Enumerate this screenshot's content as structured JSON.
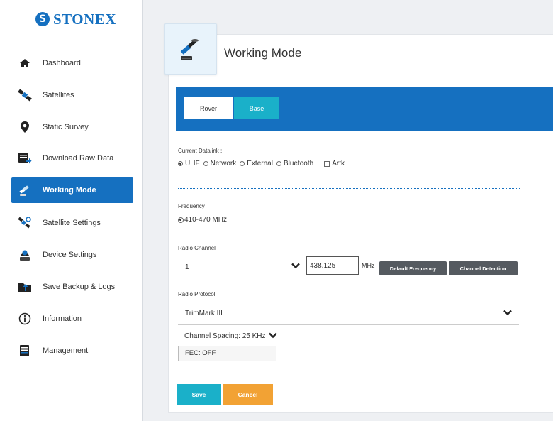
{
  "brand": {
    "logo_mark": "S",
    "name": "STONEX",
    "color": "#1570c0"
  },
  "sidebar": {
    "items": [
      {
        "label": "Dashboard",
        "icon": "house-icon",
        "active": false
      },
      {
        "label": "Satellites",
        "icon": "satellite-icon",
        "active": false
      },
      {
        "label": "Static Survey",
        "icon": "map-pin-icon",
        "active": false
      },
      {
        "label": "Download Raw Data",
        "icon": "download-icon",
        "active": false
      },
      {
        "label": "Working Mode",
        "icon": "gnss-receiver-icon",
        "active": true
      },
      {
        "label": "Satellite Settings",
        "icon": "satellite-settings-icon",
        "active": false
      },
      {
        "label": "Device Settings",
        "icon": "device-settings-icon",
        "active": false
      },
      {
        "label": "Save Backup & Logs",
        "icon": "folder-upload-icon",
        "active": false
      },
      {
        "label": "Information",
        "icon": "info-icon",
        "active": false
      },
      {
        "label": "Management",
        "icon": "management-icon",
        "active": false
      }
    ]
  },
  "page": {
    "title": "Working Mode",
    "tabs": [
      {
        "label": "Rover",
        "selected": true
      },
      {
        "label": "Base",
        "selected": false
      }
    ]
  },
  "form": {
    "datalink_label": "Current Datalink :",
    "datalink_options": [
      {
        "label": "UHF",
        "checked": true
      },
      {
        "label": "Network",
        "checked": false
      },
      {
        "label": "External",
        "checked": false
      },
      {
        "label": "Bluetooth",
        "checked": false
      }
    ],
    "artk_label": "Artk",
    "artk_checked": false,
    "frequency_label": "Frequency",
    "frequency_value": "410-470 MHz",
    "radio_channel_label": "Radio Channel",
    "radio_channel_value": "1",
    "channel_freq_value": "438.125",
    "mhz_label": "MHz",
    "default_frequency_button": "Default Frequency",
    "channel_detection_button": "Channel Detection",
    "radio_protocol_label": "Radio Protocol",
    "radio_protocol_value": "TrimMark III",
    "channel_spacing_value": "Channel Spacing: 25 KHz",
    "fec_value": "FEC: OFF",
    "save_button": "Save",
    "cancel_button": "Cancel"
  },
  "colors": {
    "primary_blue": "#1570c0",
    "teal": "#1ab0c9",
    "orange": "#f2a234",
    "dark_button": "#555a60"
  }
}
